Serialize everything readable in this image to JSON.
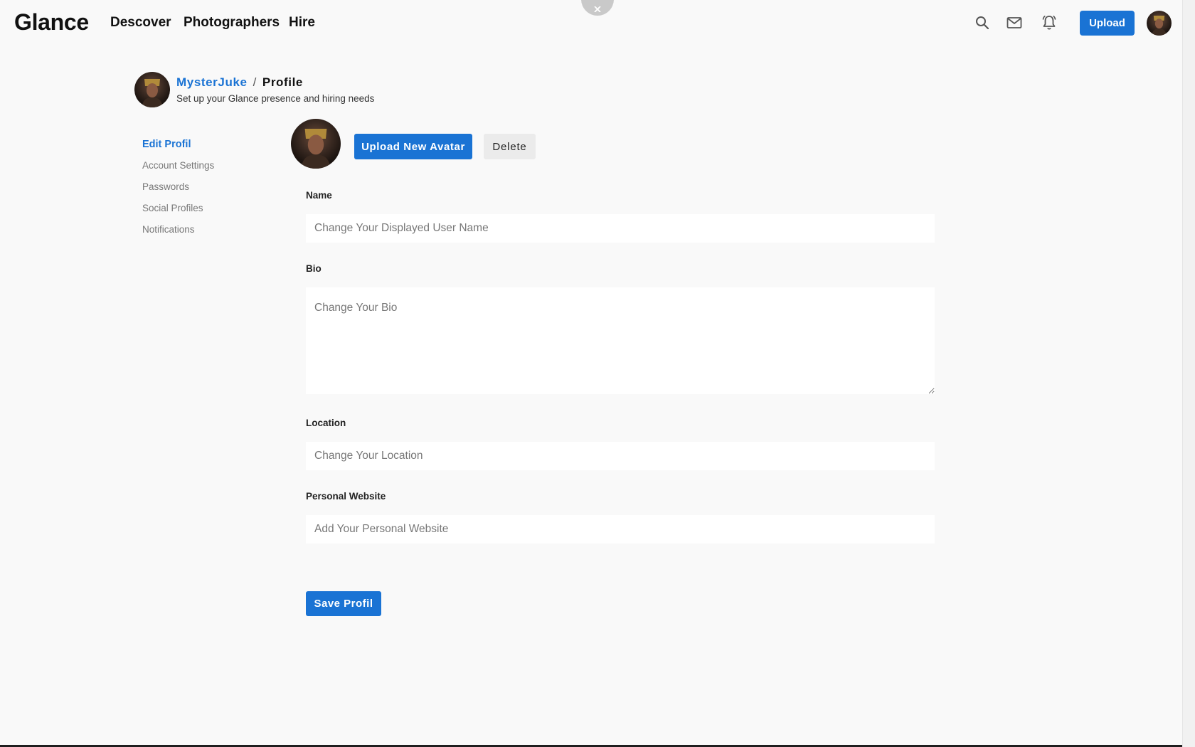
{
  "nav": {
    "logo": "Glance",
    "links": [
      "Descover",
      "Photographers",
      "Hire"
    ],
    "upload_label": "Upload",
    "icons": [
      "search-icon",
      "mail-icon",
      "bell-icon"
    ]
  },
  "header": {
    "username": "MysterJuke",
    "separator": "/",
    "page": "Profile",
    "subtitle": "Set up your Glance presence and hiring needs"
  },
  "sidebar": {
    "items": [
      {
        "label": "Edit Profil",
        "active": true
      },
      {
        "label": "Account Settings",
        "active": false
      },
      {
        "label": "Passwords",
        "active": false
      },
      {
        "label": "Social Profiles",
        "active": false
      },
      {
        "label": "Notifications",
        "active": false
      }
    ]
  },
  "avatar_actions": {
    "upload_label": "Upload New Avatar",
    "delete_label": "Delete"
  },
  "form": {
    "name": {
      "label": "Name",
      "placeholder": "Change Your Displayed User Name",
      "value": ""
    },
    "bio": {
      "label": "Bio",
      "placeholder": "Change Your Bio",
      "value": ""
    },
    "location": {
      "label": "Location",
      "placeholder": "Change Your Location",
      "value": ""
    },
    "website": {
      "label": "Personal Website",
      "placeholder": "Add Your Personal Website",
      "value": ""
    },
    "save_label": "Save Profil"
  },
  "colors": {
    "accent": "#1a73d4",
    "background": "#f9f9f9",
    "muted_text": "#777777"
  }
}
